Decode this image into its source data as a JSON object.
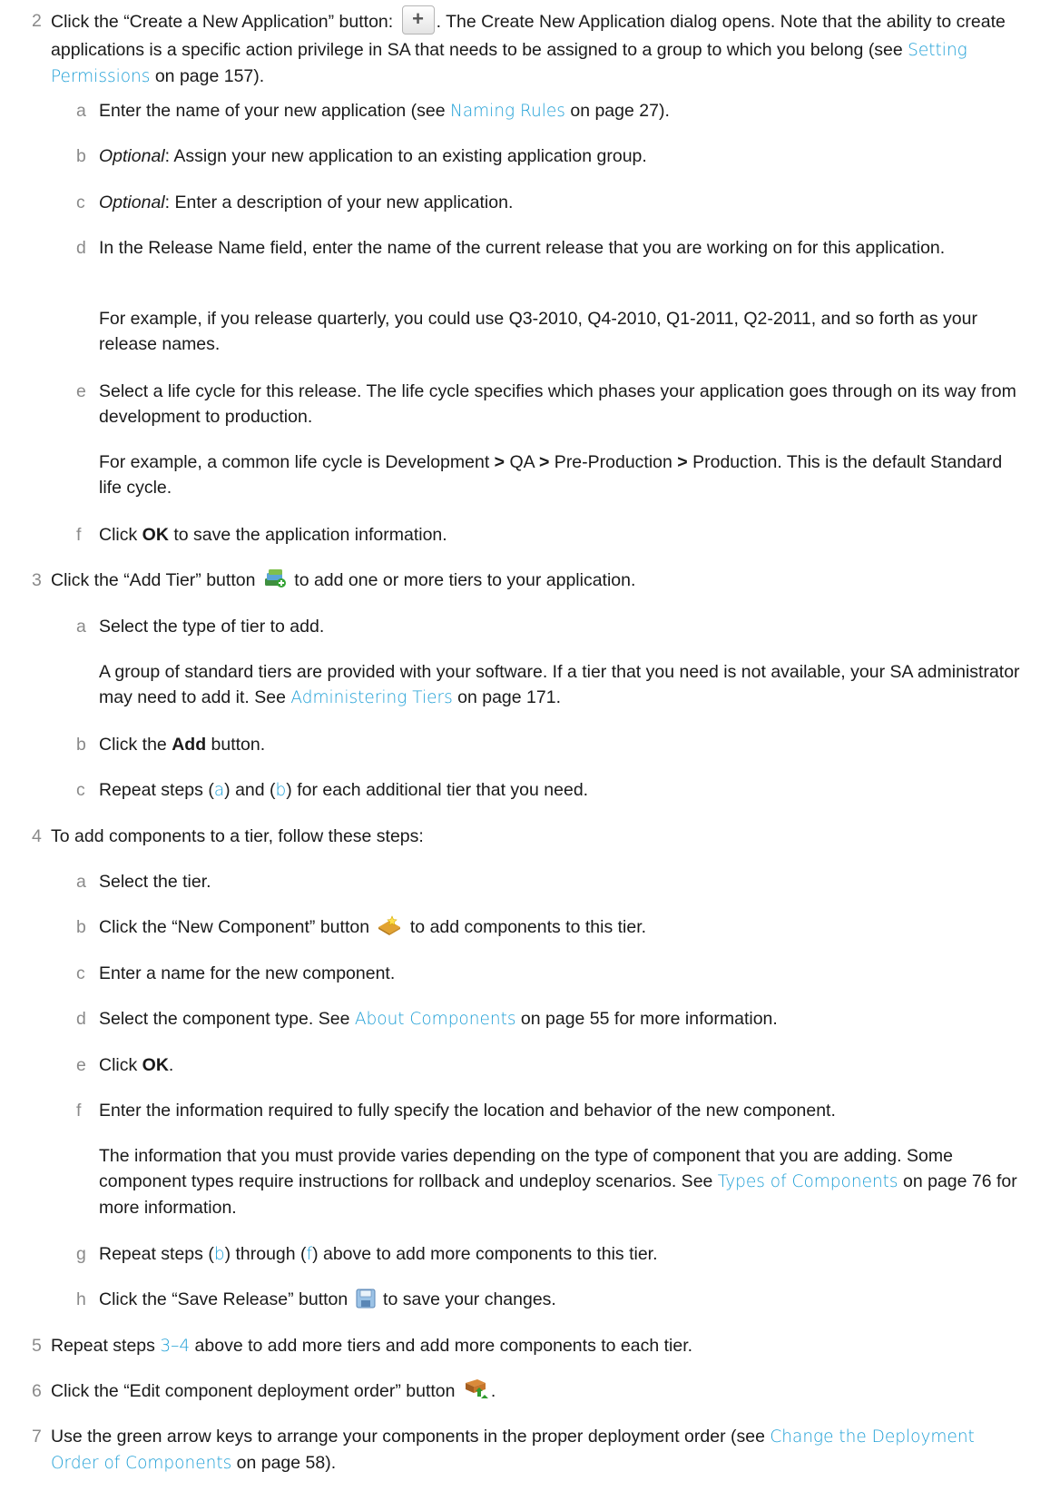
{
  "steps": [
    {
      "number": "2",
      "pre": "Click the “Create a New Application” button: ",
      "icon": "create-application-plus-icon",
      "post_a": ". The Create New Application dialog opens. Note that the ability to create applications is a specific action privilege in SA that needs to be assigned to a group to which you belong (see ",
      "link": "Setting Permissions",
      "post_b": " on page 157).",
      "substeps": [
        {
          "letter": "a",
          "pre": "Enter the name of your new application (see ",
          "link": "Naming Rules",
          "post": " on page 27)."
        },
        {
          "letter": "b",
          "em": "Optional",
          "text": ": Assign your new application to an existing application group."
        },
        {
          "letter": "c",
          "em": "Optional",
          "text": ": Enter a description of your new application."
        },
        {
          "letter": "d",
          "text": "In the Release Name field, enter the name of the current release that you are working on for this application.",
          "para": "For example, if you release quarterly, you could use Q3-2010, Q4-2010, Q1-2011, Q2-2011, and so forth as your release names."
        },
        {
          "letter": "e",
          "text": "Select a life cycle for this release. The life cycle specifies which phases your application goes through on its way from development to production.",
          "para_parts": [
            "For example, a common life cycle is Development ",
            ">",
            " QA ",
            ">",
            " Pre-Production ",
            ">",
            " Production. This is the default Standard life cycle."
          ]
        },
        {
          "letter": "f",
          "pre": "Click ",
          "bold": "OK",
          "post": " to save the application information."
        }
      ]
    },
    {
      "number": "3",
      "pre": "Click the “Add Tier” button ",
      "icon": "add-tier-icon",
      "post": " to add one or more tiers to your application.",
      "substeps": [
        {
          "letter": "a",
          "text": "Select the type of tier to add.",
          "para_pre": "A group of standard tiers are provided with your software. If a tier that you need is not available, your SA administrator may need to add it. See ",
          "para_link": "Administering Tiers",
          "para_post": " on page 171."
        },
        {
          "letter": "b",
          "pre": "Click the ",
          "bold": "Add",
          "post": " button."
        },
        {
          "letter": "c",
          "parts": [
            "Repeat steps (",
            "a",
            ") and (",
            "b",
            ") for each additional tier that you need."
          ]
        }
      ]
    },
    {
      "number": "4",
      "text": "To add components to a tier, follow these steps:",
      "substeps": [
        {
          "letter": "a",
          "text": "Select the tier."
        },
        {
          "letter": "b",
          "pre": "Click the “New Component” button ",
          "icon": "new-component-icon",
          "post": " to add components to this tier."
        },
        {
          "letter": "c",
          "text": "Enter a name for the new component."
        },
        {
          "letter": "d",
          "pre": "Select the component type. See ",
          "link": "About Components",
          "post": " on page 55 for more information."
        },
        {
          "letter": "e",
          "pre": "Click ",
          "bold": "OK",
          "post": "."
        },
        {
          "letter": "f",
          "text": "Enter the information required to fully specify the location and behavior of the new component.",
          "para_pre": "The information that you must provide varies depending on the type of component that you are adding. Some component types require instructions for rollback and undeploy scenarios. See ",
          "para_link": "Types of Components",
          "para_post": " on page 76 for more information."
        },
        {
          "letter": "g",
          "parts": [
            "Repeat steps (",
            "b",
            ") through (",
            "f",
            ") above to add more components to this tier."
          ]
        },
        {
          "letter": "h",
          "pre": "Click the “Save Release” button ",
          "icon": "save-release-icon",
          "post": " to save your changes."
        }
      ]
    },
    {
      "number": "5",
      "parts": [
        "Repeat steps ",
        "3",
        "–",
        "4",
        " above to add more tiers and add more components to each tier."
      ]
    },
    {
      "number": "6",
      "pre": "Click the “Edit component deployment order” button ",
      "icon": "deployment-order-icon",
      "post": "."
    },
    {
      "number": "7",
      "pre": "Use the green arrow keys to arrange your components in the proper deployment order (see ",
      "link": "Change the Deployment Order of Components",
      "post": " on page 58)."
    }
  ],
  "colors": {
    "link": "#1e9fd6",
    "step_number": "#8a8a8a",
    "text": "#1a1a1a"
  }
}
